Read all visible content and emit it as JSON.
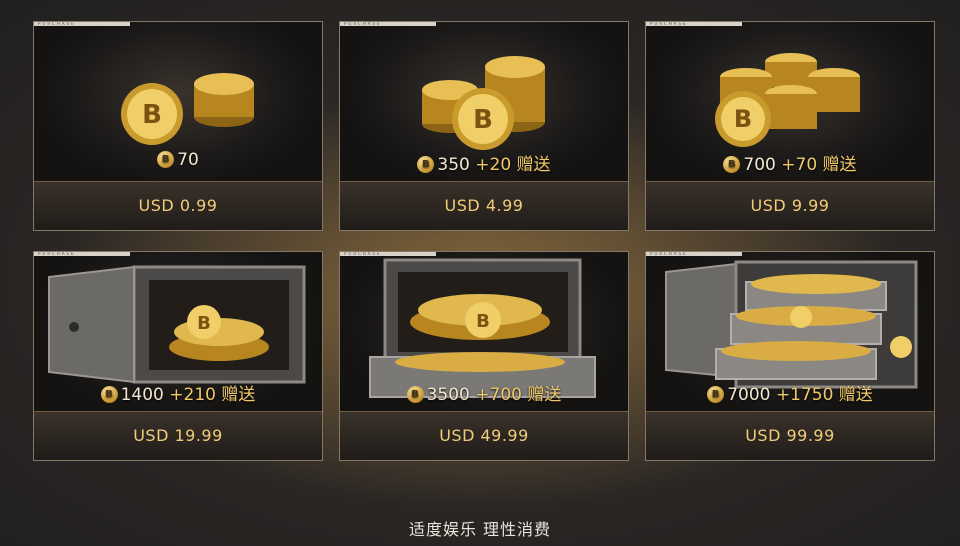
{
  "card_tag": "PURCHASE",
  "packages": [
    {
      "amount": "70",
      "bonus": "",
      "price": "USD 0.99",
      "art": "coins-small"
    },
    {
      "amount": "350",
      "bonus": "+20 赠送",
      "price": "USD 4.99",
      "art": "coins-stack"
    },
    {
      "amount": "700",
      "bonus": "+70 赠送",
      "price": "USD 9.99",
      "art": "coins-pile"
    },
    {
      "amount": "1400",
      "bonus": "+210 赠送",
      "price": "USD 19.99",
      "art": "safe-open"
    },
    {
      "amount": "3500",
      "bonus": "+700 赠送",
      "price": "USD 49.99",
      "art": "safe-drawer"
    },
    {
      "amount": "7000",
      "bonus": "+1750 赠送",
      "price": "USD 99.99",
      "art": "safe-full"
    }
  ],
  "footer": {
    "text": "适度娱乐 理性消费"
  },
  "colors": {
    "price": "#f1cc7a",
    "bonus": "#f0c96a",
    "coin": "#d5a43c"
  }
}
